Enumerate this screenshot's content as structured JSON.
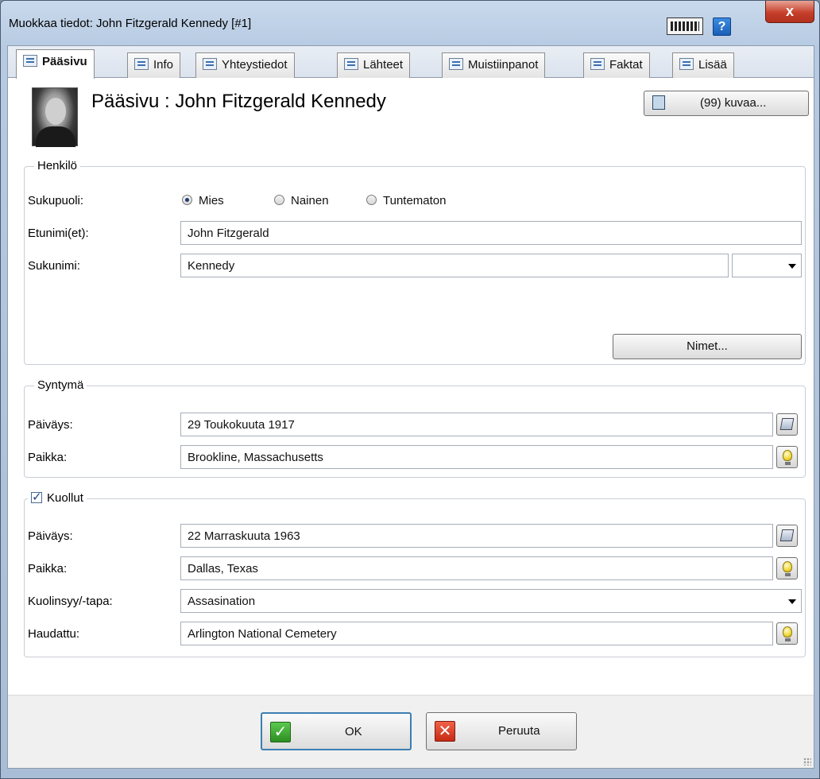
{
  "window": {
    "title": "Muokkaa tiedot: John Fitzgerald Kennedy [#1]",
    "help_label": "?",
    "close_label": "x"
  },
  "tabs": [
    {
      "label": "Pääsivu",
      "icon": "person-card-icon",
      "active": true
    },
    {
      "label": "Info",
      "icon": "info-icon"
    },
    {
      "label": "Yhteystiedot",
      "icon": "home-icon"
    },
    {
      "label": "Lähteet",
      "icon": "sources-icon"
    },
    {
      "label": "Muistiinpanot",
      "icon": "notes-icon"
    },
    {
      "label": "Faktat",
      "icon": "facts-icon"
    },
    {
      "label": "Lisää",
      "icon": "add-icon"
    }
  ],
  "header": {
    "title": "Pääsivu : John Fitzgerald Kennedy",
    "photos_button": "(99) kuvaa..."
  },
  "person": {
    "legend": "Henkilö",
    "gender_label": "Sukupuoli:",
    "gender_options": [
      "Mies",
      "Nainen",
      "Tuntematon"
    ],
    "gender_selected": "Mies",
    "firstname_label": "Etunimi(et):",
    "firstname_value": "John Fitzgerald",
    "surname_label": "Sukunimi:",
    "surname_value": "Kennedy",
    "surname_suffix_value": "",
    "names_button": "Nimet..."
  },
  "birth": {
    "legend": "Syntymä",
    "date_label": "Päiväys:",
    "date_value": "29 Toukokuuta 1917",
    "place_label": "Paikka:",
    "place_value": "Brookline, Massachusetts"
  },
  "death": {
    "legend": "Kuollut",
    "checked": true,
    "date_label": "Päiväys:",
    "date_value": "22 Marraskuuta 1963",
    "place_label": "Paikka:",
    "place_value": "Dallas, Texas",
    "cause_label": "Kuolinsyy/-tapa:",
    "cause_value": "Assasination",
    "burial_label": "Haudattu:",
    "burial_value": "Arlington National Cemetery"
  },
  "footer": {
    "ok_label": "OK",
    "cancel_label": "Peruuta"
  }
}
